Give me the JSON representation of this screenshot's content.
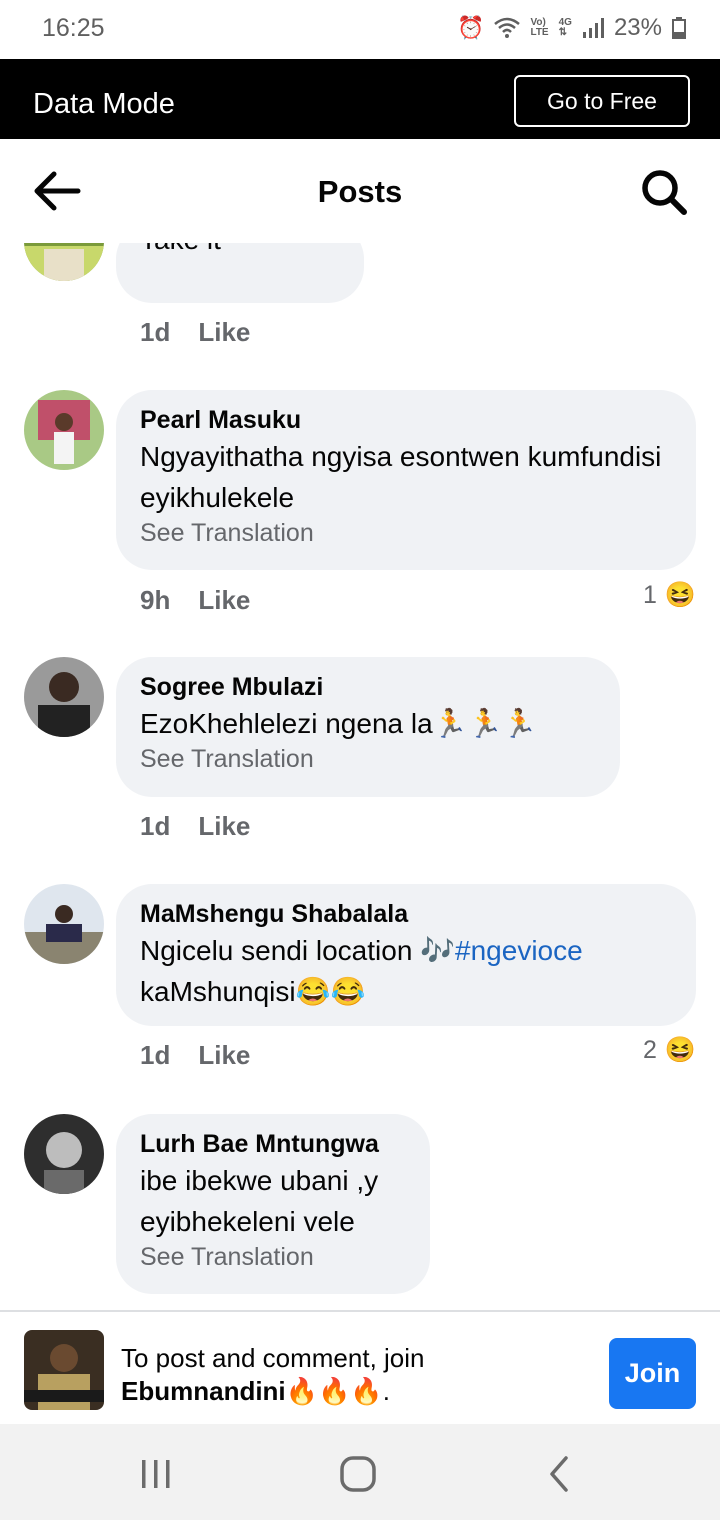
{
  "status_bar": {
    "time": "16:25",
    "net_volte": "Vo)",
    "net_lte": "LTE",
    "net_4g": "4G",
    "battery": "23%"
  },
  "data_mode": {
    "label": "Data Mode",
    "button": "Go to Free"
  },
  "header": {
    "title": "Posts"
  },
  "comments": [
    {
      "author": "",
      "text": "Take it",
      "time": "1d",
      "like": "Like"
    },
    {
      "author": "Pearl Masuku",
      "text": "Ngyayithatha ngyisa esontwen kumfundisi eyikhulekele",
      "translate": "See Translation",
      "time": "9h",
      "like": "Like",
      "reaction_count": "1",
      "reaction_emoji": "😆"
    },
    {
      "author": "Sogree Mbulazi",
      "text": "EzoKhehlelezi ngena la🏃🏃🏃",
      "translate": "See Translation",
      "time": "1d",
      "like": "Like"
    },
    {
      "author": "MaMshengu Shabalala",
      "text_a": "Ngicelu sendi location 🎶",
      "hashtag": "#ngevioce",
      "text_b": "kaMshunqisi😂😂",
      "time": "1d",
      "like": "Like",
      "reaction_count": "2",
      "reaction_emoji": "😆"
    },
    {
      "author": "Lurh Bae Mntungwa",
      "text": "ibe ibekwe ubani ,y eyibhekeleni vele",
      "translate": "See Translation"
    }
  ],
  "join_bar": {
    "prompt": "To post and comment, join",
    "group": "Ebumnandini🔥🔥🔥",
    "period": ".",
    "button": "Join"
  },
  "nav": {
    "recents": "recents-icon",
    "home": "home-icon",
    "back": "back-icon"
  }
}
